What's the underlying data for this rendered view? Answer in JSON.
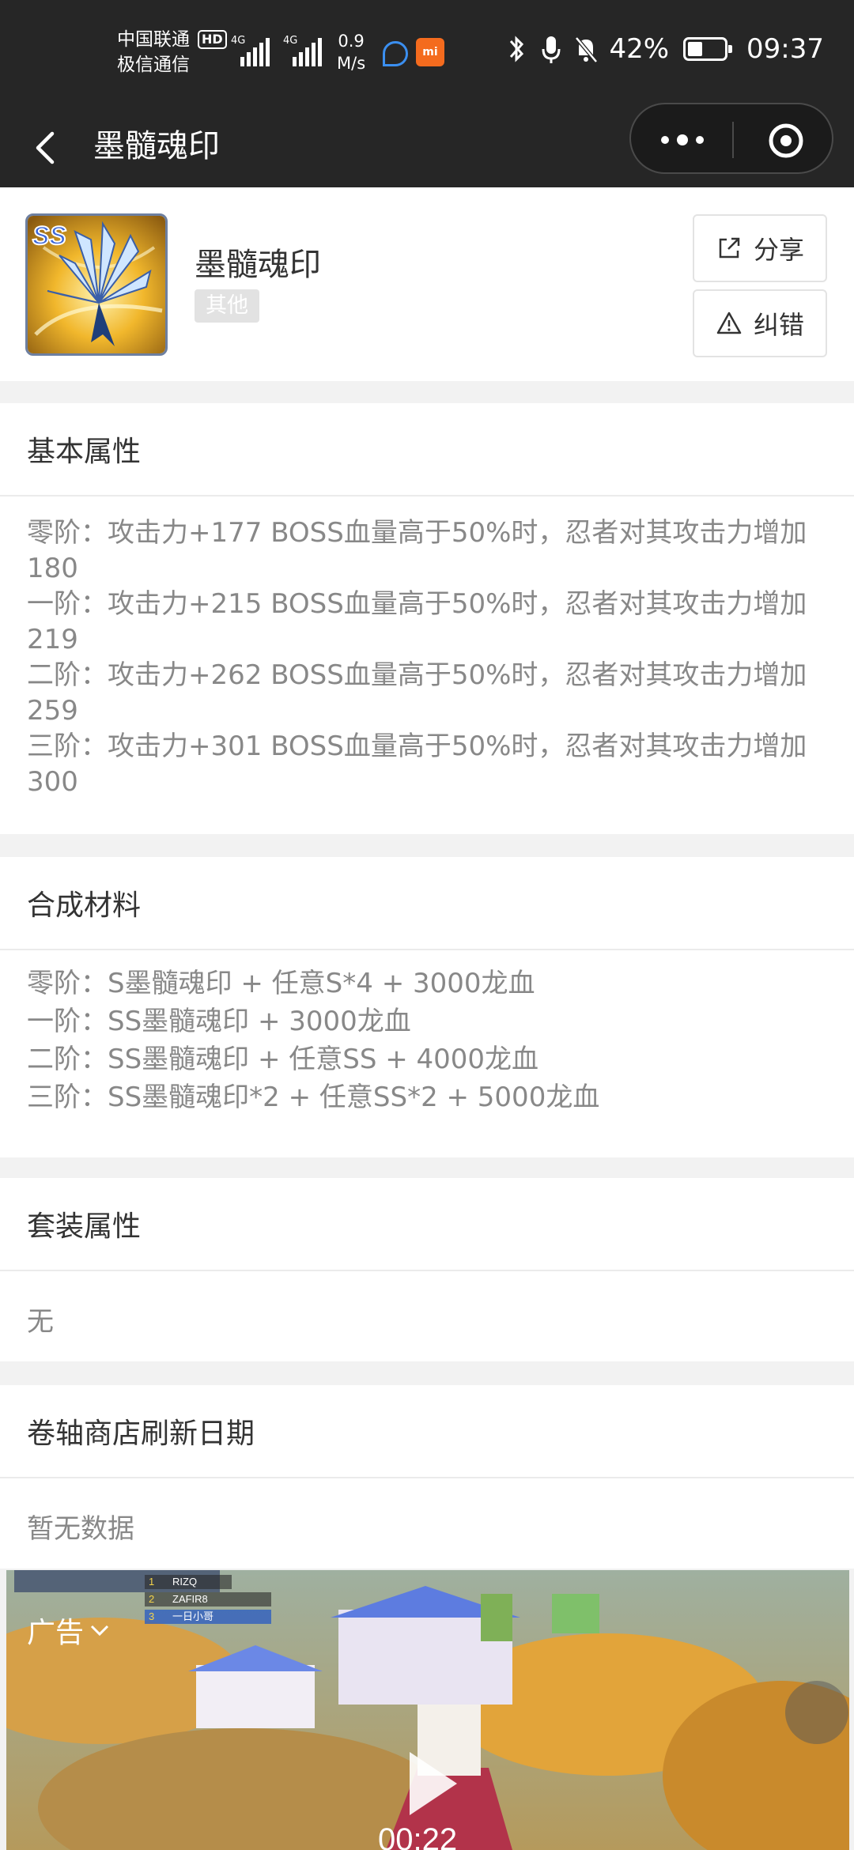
{
  "status_bar": {
    "carrier1": "中国联通",
    "carrier2": "极信通信",
    "hd": "HD",
    "net1": "4G",
    "net2": "4G",
    "speed_value": "0.9",
    "speed_unit": "M/s",
    "app_badge": "mi",
    "battery_percent": "42%",
    "battery_level": 0.42,
    "time": "09:37"
  },
  "nav": {
    "title": "墨髓魂印"
  },
  "item": {
    "name": "墨髓魂印",
    "tag": "其他",
    "badge": "SS",
    "share_label": "分享",
    "report_label": "纠错"
  },
  "sections": {
    "basic": {
      "title": "基本属性",
      "lines": [
        "零阶：攻击力+177 BOSS血量高于50%时，忍者对其攻击力增加",
        "180",
        "一阶：攻击力+215 BOSS血量高于50%时，忍者对其攻击力增加",
        "219",
        "二阶：攻击力+262 BOSS血量高于50%时，忍者对其攻击力增加",
        "259",
        "三阶：攻击力+301 BOSS血量高于50%时，忍者对其攻击力增加",
        "300"
      ]
    },
    "materials": {
      "title": "合成材料",
      "lines": [
        "零阶：S墨髓魂印 + 任意S*4 + 3000龙血",
        "一阶：SS墨髓魂印 + 3000龙血",
        "二阶：SS墨髓魂印 + 任意SS + 4000龙血",
        "三阶：SS墨髓魂印*2 + 任意SS*2 + 5000龙血"
      ]
    },
    "set": {
      "title": "套装属性",
      "value": "无"
    },
    "scroll_shop": {
      "title": "卷轴商店刷新日期",
      "value": "暂无数据"
    }
  },
  "ad": {
    "label": "广告",
    "players": [
      "RIZQ",
      "ZAFIR8",
      "一日小哥"
    ],
    "rank_numbers": [
      "1",
      "2",
      "3"
    ],
    "timer": "00:22"
  },
  "colors": {
    "status_bg": "#262626",
    "page_bg": "#f2f2f2",
    "card_bg": "#ffffff",
    "muted_text": "#888888"
  }
}
